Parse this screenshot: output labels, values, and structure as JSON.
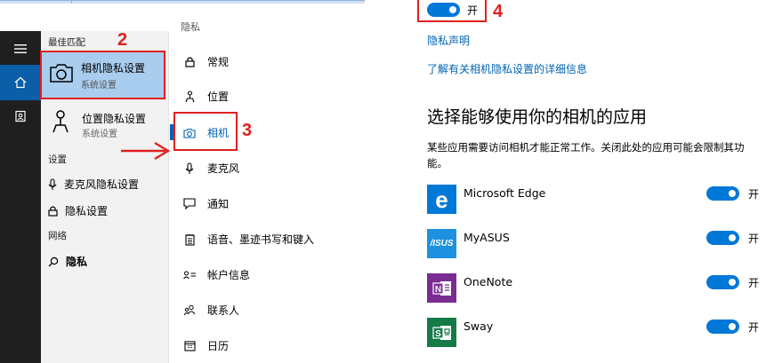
{
  "start_search": {
    "rail": {
      "menu_icon": "hamburger-icon",
      "home_icon": "home-icon",
      "settings_icon": "settings-icon"
    },
    "best_match_label": "最佳匹配",
    "best_match": {
      "title": "相机隐私设置",
      "subtitle": "系统设置",
      "icon": "camera-icon"
    },
    "second_result": {
      "title": "位置隐私设置",
      "subtitle": "系统设置",
      "icon": "location-icon"
    },
    "settings_label": "设置",
    "settings_items": [
      {
        "label": "麦克风隐私设置",
        "icon": "microphone-icon"
      },
      {
        "label": "隐私设置",
        "icon": "lock-icon"
      }
    ],
    "web_label": "网络",
    "web_items": [
      {
        "label": "隐私",
        "icon": "search-icon"
      }
    ]
  },
  "privacy_nav": {
    "header": "隐私",
    "items": [
      {
        "label": "常规",
        "icon": "lock-icon"
      },
      {
        "label": "位置",
        "icon": "location-icon"
      },
      {
        "label": "相机",
        "icon": "camera-icon",
        "selected": true
      },
      {
        "label": "麦克风",
        "icon": "microphone-icon"
      },
      {
        "label": "通知",
        "icon": "chat-bubble-icon"
      },
      {
        "label": "语音、墨迹书写和键入",
        "icon": "notepad-icon"
      },
      {
        "label": "帐户信息",
        "icon": "contact-card-icon"
      },
      {
        "label": "联系人",
        "icon": "people-icon"
      },
      {
        "label": "日历",
        "icon": "calendar-icon"
      }
    ]
  },
  "camera_settings": {
    "master_toggle": {
      "state": "on",
      "label": "开"
    },
    "privacy_statement_link": "隐私声明",
    "learn_more_link": "了解有关相机隐私设置的详细信息",
    "section_heading": "选择能够使用你的相机的应用",
    "section_description": "某些应用需要访问相机才能正常工作。关闭此处的应用可能会限制其功能。",
    "apps": [
      {
        "name": "Microsoft Edge",
        "toggle": "on",
        "toggle_label": "开",
        "tile_color": "#0078d7",
        "icon": "edge-icon"
      },
      {
        "name": "MyASUS",
        "toggle": "on",
        "toggle_label": "开",
        "tile_color": "#1e90e0",
        "icon": "myasus-icon"
      },
      {
        "name": "OneNote",
        "toggle": "on",
        "toggle_label": "开",
        "tile_color": "#7b2c91",
        "icon": "onenote-icon"
      },
      {
        "name": "Sway",
        "toggle": "on",
        "toggle_label": "开",
        "tile_color": "#167a47",
        "icon": "sway-icon"
      }
    ]
  },
  "annotations": [
    {
      "number": "2"
    },
    {
      "number": "3"
    },
    {
      "number": "4"
    }
  ],
  "colors": {
    "accent": "#0078d7",
    "link": "#0063b1",
    "selection": "#a9cdee",
    "annotation_red": "#e02020"
  }
}
